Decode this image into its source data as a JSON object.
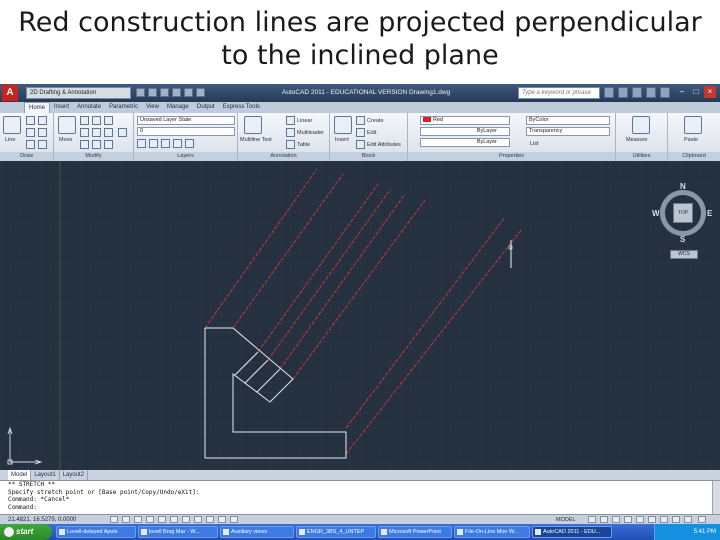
{
  "slide": {
    "title_line1": "Red construction lines are projected perpendicular",
    "title_line2": "to the inclined plane"
  },
  "titlebar": {
    "workspace": "2D Drafting & Annotation",
    "window_title": "AutoCAD 2011 - EDUCATIONAL VERSION   Drawing1.dwg",
    "help_search_placeholder": "Type a keyword or phrase"
  },
  "ribbon": {
    "tabs": [
      "Home",
      "Insert",
      "Annotate",
      "Parametric",
      "View",
      "Manage",
      "Output",
      "Express Tools"
    ],
    "active_tab": "Home",
    "panels": {
      "draw": "Draw",
      "modify": "Modify",
      "layers": "Layers",
      "annotation": "Annotation",
      "block": "Block",
      "properties": "Properties",
      "utilities": "Utilities",
      "clipboard": "Clipboard"
    },
    "draw_tools": {
      "line": "Line"
    },
    "modify_tools": {
      "move": "Move"
    },
    "layers_tools": {
      "layer_state": "Unsaved Layer State",
      "current_layer": "0"
    },
    "annotation_tools": {
      "multiline_text": "Multiline Text",
      "linear": "Linear",
      "multileader": "Multileader",
      "table": "Table"
    },
    "block_tools": {
      "insert": "Insert",
      "create": "Create",
      "edit": "Edit",
      "edit_attributes": "Edit Attributes"
    },
    "properties_tools": {
      "color": "Red",
      "linetype": "ByLayer",
      "lineweight": "ByLayer",
      "plot_style": "ByColor",
      "transparency": "Transparency",
      "list": "List"
    },
    "utilities_tools": {
      "measure": "Measure"
    },
    "clipboard_tools": {
      "paste": "Paste"
    }
  },
  "viewcube": {
    "north": "N",
    "south": "S",
    "east": "E",
    "west": "W",
    "face": "TOP",
    "wcs": "WCS"
  },
  "layout_tabs": [
    "Model",
    "Layout1",
    "Layout2"
  ],
  "command_line": [
    "** STRETCH **",
    "Specify stretch point or [Base point/Copy/Undo/eXit]:",
    "Command: *Cancel*",
    "Command:"
  ],
  "statusbar": {
    "coordinates": "21.4821, 16.5279, 0.0000",
    "space": "MODEL"
  },
  "taskbar": {
    "start": "start",
    "tasks": [
      "Lovell-delayed Apuls",
      "lovell Brsg Mar - W...",
      "Auxiliary views",
      "ENGR_3BS_4_UNTEP",
      "Microsoft PowerPoint",
      "File-On-Line Mon W...",
      "AutoCAD 2011 - EDU..."
    ],
    "active_task_index": 6,
    "clock": "5:41 PM"
  },
  "colors": {
    "canvas": "#253040",
    "construction_line": "#d43a3a",
    "object_line": "#e8ecf0"
  }
}
